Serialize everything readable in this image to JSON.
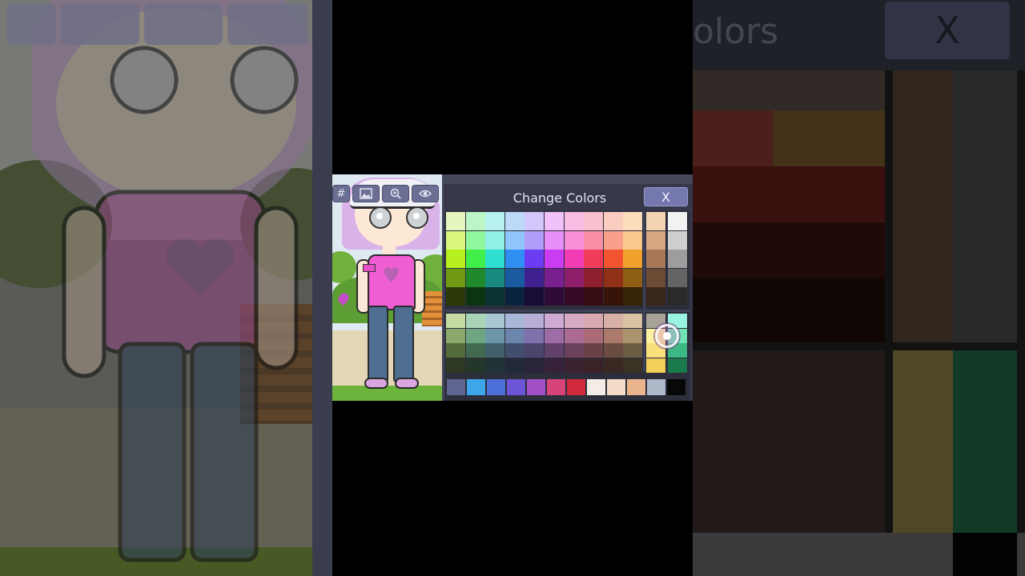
{
  "dialog": {
    "title": "Change Colors",
    "close_label": "X"
  },
  "toolbar": {
    "hash_label": "#",
    "buttons": [
      "hash-icon",
      "image-icon",
      "zoom-in-icon",
      "eye-icon"
    ]
  },
  "palette": {
    "main_rows": [
      [
        "#e6f6bf",
        "#bdf6c6",
        "#b8f2ee",
        "#bcd9fa",
        "#d3c6fa",
        "#f1c1fa",
        "#f9bde5",
        "#f9c1cd",
        "#fbccc0",
        "#fbdcbb"
      ],
      [
        "#d7f67b",
        "#8ff79c",
        "#8ff0e7",
        "#8fc5fa",
        "#b29cfa",
        "#e98ffa",
        "#f990d7",
        "#f98fa7",
        "#fa9f8c",
        "#f9c98c"
      ],
      [
        "#b6f01f",
        "#41ef4b",
        "#2fdfd1",
        "#2f8ff3",
        "#6b3cf1",
        "#c93cf1",
        "#f13cb5",
        "#f13c5a",
        "#f1542e",
        "#f1a02e"
      ],
      [
        "#6f9a12",
        "#1f8a2b",
        "#188a80",
        "#1a5aa0",
        "#3f208f",
        "#791f8f",
        "#8f1f6a",
        "#8f1f2d",
        "#8f3116",
        "#8f5f16"
      ],
      [
        "#2b3a08",
        "#0b3511",
        "#093431",
        "#0a2440",
        "#190c37",
        "#2e0c37",
        "#370b28",
        "#370b12",
        "#371308",
        "#372508"
      ]
    ],
    "skin_column": [
      "#f4d5b3",
      "#d6a680",
      "#a77858",
      "#6d4b34",
      "#3b281c"
    ],
    "gray_column": [
      "#f2f2f2",
      "#cfcfcf",
      "#9d9d9d",
      "#646464",
      "#2a2a2a"
    ],
    "muted_rows": [
      [
        "#c7dca5",
        "#a9d4b6",
        "#a8c7d3",
        "#a9b7d8",
        "#b8aed8",
        "#cfaad3",
        "#d7a9c3",
        "#d8a9ae",
        "#d8b0a6",
        "#d8c2a2"
      ],
      [
        "#8ca86b",
        "#6ea582",
        "#6c97a8",
        "#6c85ac",
        "#7f72ac",
        "#9e6ca7",
        "#ab6b92",
        "#ab6b76",
        "#ab7a6b",
        "#ab946b"
      ],
      [
        "#556b3c",
        "#426a51",
        "#41606b",
        "#414f6d",
        "#4d446d",
        "#62416a",
        "#6b415b",
        "#6b4148",
        "#6b4c41",
        "#6b5d41"
      ],
      [
        "#2d3920",
        "#23382a",
        "#223338",
        "#222a3a",
        "#29243a",
        "#352238",
        "#3a2230",
        "#3a2226",
        "#3a2822",
        "#3a3222"
      ]
    ],
    "muted_skin_column": [
      "#a7a398",
      "#fef1a1",
      "#f9e07a",
      "#f3ce58"
    ],
    "muted_green_column": [
      "#9af5e0",
      "#6ee3b4",
      "#3bb883",
      "#1b7a4b"
    ],
    "bottom_row": [
      "#5f6490",
      "#3da6e8",
      "#4c6fd8",
      "#6c55d6",
      "#a250c8",
      "#d6447a",
      "#d22a3c",
      "#f4ece6",
      "#f2dcc7",
      "#eab58c",
      "#aeb8c8",
      "#080808"
    ]
  }
}
